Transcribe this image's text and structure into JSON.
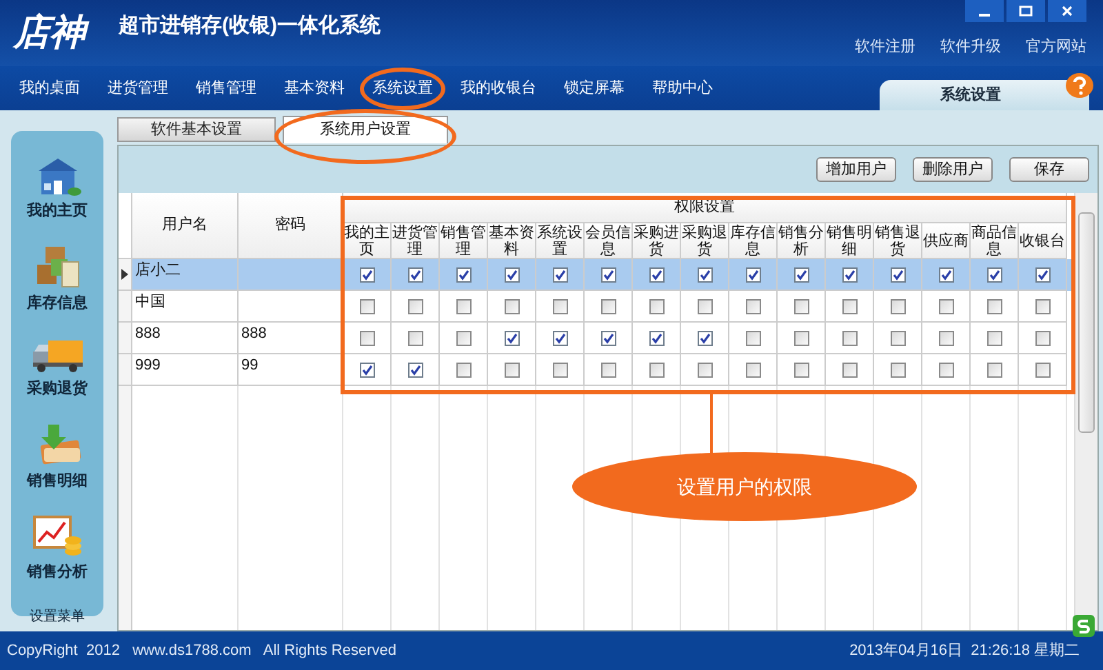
{
  "window": {
    "logo": "店神",
    "title": "超市进销存(收银)一体化系统"
  },
  "top_links": [
    "软件注册",
    "软件升级",
    "官方网站"
  ],
  "nav": [
    {
      "label": "我的桌面",
      "circled": false
    },
    {
      "label": "进货管理",
      "circled": false
    },
    {
      "label": "销售管理",
      "circled": false
    },
    {
      "label": "基本资料",
      "circled": false
    },
    {
      "label": "系统设置",
      "circled": true
    },
    {
      "label": "我的收银台",
      "circled": false
    },
    {
      "label": "锁定屏幕",
      "circled": false
    },
    {
      "label": "帮助中心",
      "circled": false
    }
  ],
  "panel_title": "系统设置",
  "sidebar": {
    "items": [
      {
        "label": "我的主页",
        "kind": "house"
      },
      {
        "label": "库存信息",
        "kind": "boxes"
      },
      {
        "label": "采购退货",
        "kind": "truck"
      },
      {
        "label": "销售明细",
        "kind": "card"
      },
      {
        "label": "销售分析",
        "kind": "chart"
      }
    ],
    "footer": "设置菜单"
  },
  "tabs": [
    {
      "label": "软件基本设置",
      "selected": false,
      "circled": false
    },
    {
      "label": "系统用户设置",
      "selected": true,
      "circled": true
    }
  ],
  "buttons": [
    "增加用户",
    "删除用户",
    "保存"
  ],
  "grid": {
    "columns": [
      "用户名",
      "密码"
    ],
    "group_header": "权限设置",
    "permissions": [
      "我的主页",
      "进货管理",
      "销售管理",
      "基本资料",
      "系统设置",
      "会员信息",
      "采购进货",
      "采购退货",
      "库存信息",
      "销售分析",
      "销售明细",
      "销售退货",
      "供应商",
      "商品信息",
      "收银台"
    ],
    "rows": [
      {
        "name": "店小二",
        "selected": true,
        "cells": [
          {
            "checked": true
          },
          {
            "checked": true
          },
          {
            "checked": true
          },
          {
            "checked": true
          },
          {
            "checked": true
          },
          {
            "checked": true
          },
          {
            "checked": true
          },
          {
            "checked": true
          },
          {
            "checked": true
          },
          {
            "checked": true
          },
          {
            "checked": true
          },
          {
            "checked": true
          },
          {
            "checked": true
          },
          {
            "checked": true
          },
          {
            "checked": true
          }
        ]
      },
      {
        "name": "中国",
        "selected": false,
        "cells": [
          {
            "checked": false
          },
          {
            "checked": false
          },
          {
            "checked": false
          },
          {
            "checked": false
          },
          {
            "checked": false
          },
          {
            "checked": false
          },
          {
            "checked": false
          },
          {
            "checked": false
          },
          {
            "checked": false
          },
          {
            "checked": false
          },
          {
            "checked": false
          },
          {
            "checked": false
          },
          {
            "checked": false
          },
          {
            "checked": false
          },
          {
            "checked": false
          }
        ]
      },
      {
        "name": "888",
        "password": "888",
        "selected": false,
        "cells": [
          {
            "checked": false
          },
          {
            "checked": false
          },
          {
            "checked": false
          },
          {
            "checked": true
          },
          {
            "checked": true
          },
          {
            "checked": true
          },
          {
            "checked": true
          },
          {
            "checked": true
          },
          {
            "checked": false
          },
          {
            "checked": false
          },
          {
            "checked": false
          },
          {
            "checked": false
          },
          {
            "checked": false
          },
          {
            "checked": false
          },
          {
            "checked": false
          }
        ]
      },
      {
        "name": "999",
        "password": "99",
        "selected": false,
        "cells": [
          {
            "checked": true
          },
          {
            "checked": true
          },
          {
            "checked": false
          },
          {
            "checked": false
          },
          {
            "checked": false
          },
          {
            "checked": false
          },
          {
            "checked": false
          },
          {
            "checked": false
          },
          {
            "checked": false
          },
          {
            "checked": false
          },
          {
            "checked": false
          },
          {
            "checked": false
          },
          {
            "checked": false
          },
          {
            "checked": false
          },
          {
            "checked": false
          }
        ]
      }
    ]
  },
  "callout": "设置用户的权限",
  "status_bar": {
    "copyright": "CopyRight  2012   www.ds1788.com   All Rights Reserved",
    "datetime": "2013年04月16日  21:26:18 星期二"
  }
}
